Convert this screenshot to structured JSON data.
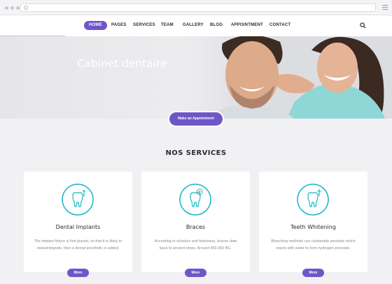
{
  "nav": {
    "items": [
      {
        "label": "HOME",
        "active": true
      },
      {
        "label": "PAGES"
      },
      {
        "label": "SERVICES"
      },
      {
        "label": "TEAM"
      },
      {
        "label": "GALLERY"
      },
      {
        "label": "BLOG"
      },
      {
        "label": "APPOINTMENT"
      },
      {
        "label": "CONTACT"
      }
    ],
    "search_icon": "search-icon"
  },
  "hero": {
    "title": "Cabinet dentaire",
    "cta": "Make an Appointment"
  },
  "services": {
    "title": "NOS SERVICES",
    "cards": [
      {
        "title": "Dental Implants",
        "text": "The implant fixture is first placed, so that it is likely to osseointegrate, then a dental prosthetic is added.",
        "more": "More",
        "icon": "tooth-implant-icon"
      },
      {
        "title": "Braces",
        "text": "According to scholars and historians, braces date back to ancient times. Around 400-300 BC.",
        "more": "More",
        "icon": "tooth-braces-icon"
      },
      {
        "title": "Teeth Whitening",
        "text": "Bleaching methods use carbamide peroxide which reacts with water to form hydrogen peroxide.",
        "more": "More",
        "icon": "tooth-whitening-icon"
      }
    ]
  },
  "colors": {
    "accent": "#6e56c8",
    "icon": "#1bb8c4",
    "text": "#2b2b35"
  }
}
